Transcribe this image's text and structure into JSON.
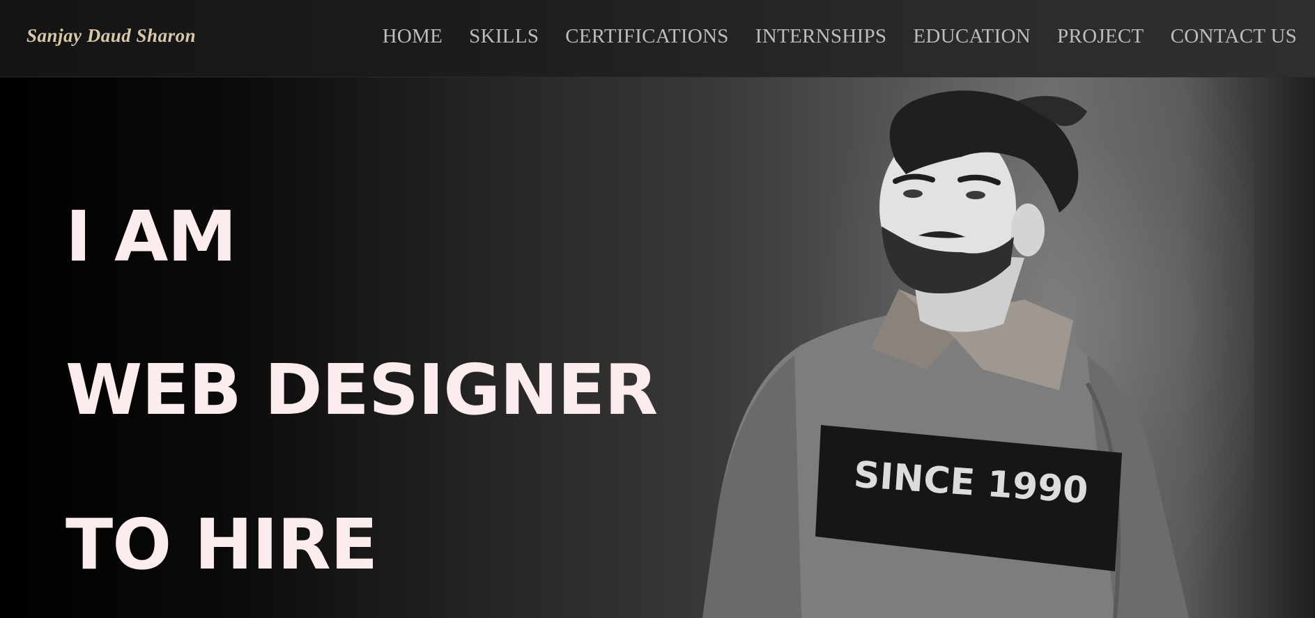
{
  "header": {
    "logo_text": "Sanjay Daud Sharon",
    "nav_items": [
      {
        "label": "HOME"
      },
      {
        "label": "SKILLS"
      },
      {
        "label": "CERTIFICATIONS"
      },
      {
        "label": "INTERNSHIPS"
      },
      {
        "label": "EDUCATION"
      },
      {
        "label": "PROJECT"
      },
      {
        "label": "CONTACT US"
      }
    ]
  },
  "hero": {
    "line1": "I AM",
    "line2": "WEB DESIGNER",
    "line3": "TO HIRE",
    "photo": {
      "subject": "person-portrait",
      "shirt_text": "SINCE 1990"
    }
  },
  "colors": {
    "headline": "#fdeced",
    "nav_text": "#bdbdbd",
    "logo": "#d9c7ac",
    "navbar_bg": "#1c1c1c"
  }
}
